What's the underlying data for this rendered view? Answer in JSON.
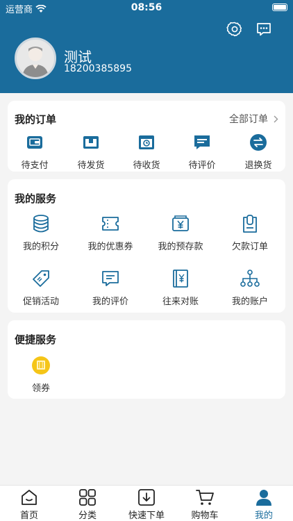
{
  "status_bar": {
    "carrier": "运营商",
    "time": "08:56"
  },
  "user": {
    "name": "测试",
    "phone": "18200385895"
  },
  "orders": {
    "title": "我的订单",
    "all_label": "全部订单",
    "items": [
      {
        "label": "待支付",
        "icon": "wallet-icon"
      },
      {
        "label": "待发货",
        "icon": "box-icon"
      },
      {
        "label": "待收货",
        "icon": "delivery-clock-icon"
      },
      {
        "label": "待评价",
        "icon": "comment-icon"
      },
      {
        "label": "退换货",
        "icon": "exchange-icon"
      }
    ]
  },
  "services": {
    "title": "我的服务",
    "items": [
      {
        "label": "我的积分",
        "icon": "coins-stack-icon"
      },
      {
        "label": "我的优惠券",
        "icon": "coupon-icon"
      },
      {
        "label": "我的预存款",
        "icon": "yuan-wallet-icon"
      },
      {
        "label": "欠款订单",
        "icon": "clipboard-icon"
      },
      {
        "label": "促销活动",
        "icon": "tag-icon"
      },
      {
        "label": "我的评价",
        "icon": "message-lines-icon"
      },
      {
        "label": "往来对账",
        "icon": "ledger-icon"
      },
      {
        "label": "我的账户",
        "icon": "org-tree-icon"
      }
    ]
  },
  "quick": {
    "title": "便捷服务",
    "items": [
      {
        "label": "领券",
        "icon": "gift-coupon-icon"
      }
    ]
  },
  "tabbar": {
    "active": "我的",
    "items": [
      {
        "label": "首页",
        "icon": "home-icon"
      },
      {
        "label": "分类",
        "icon": "grid-icon"
      },
      {
        "label": "快速下单",
        "icon": "download-box-icon"
      },
      {
        "label": "购物车",
        "icon": "cart-icon"
      },
      {
        "label": "我的",
        "icon": "person-icon"
      }
    ]
  },
  "colors": {
    "brand": "#1a6c9c",
    "background": "#f4f4f4",
    "coupon": "#f5c518"
  }
}
